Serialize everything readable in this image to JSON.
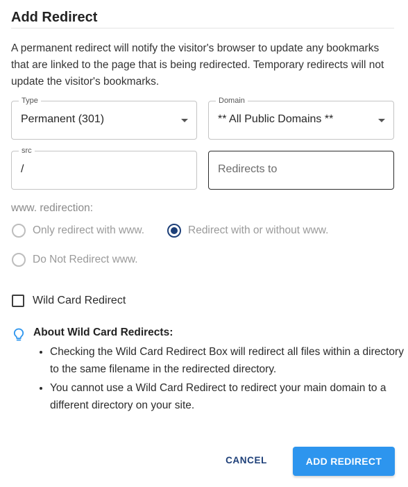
{
  "dialog": {
    "title": "Add Redirect",
    "description": "A permanent redirect will notify the visitor's browser to update any bookmarks that are linked to the page that is being redirected. Temporary redirects will not update the visitor's bookmarks."
  },
  "type_select": {
    "label": "Type",
    "value": "Permanent (301)"
  },
  "domain_select": {
    "label": "Domain",
    "value": "** All Public Domains **"
  },
  "src_field": {
    "label": "src",
    "value": "/"
  },
  "redirects_to_field": {
    "placeholder": "Redirects to",
    "value": ""
  },
  "www_redirection": {
    "label": "www. redirection:",
    "options": [
      {
        "label": "Only redirect with www.",
        "checked": false
      },
      {
        "label": "Redirect with or without www.",
        "checked": true
      },
      {
        "label": "Do Not Redirect www.",
        "checked": false
      }
    ]
  },
  "wildcard": {
    "label": "Wild Card Redirect",
    "checked": false
  },
  "info": {
    "icon": "lightbulb-icon",
    "title": "About Wild Card Redirects:",
    "items": [
      "Checking the Wild Card Redirect Box will redirect all files within a directory to the same filename in the redirected directory.",
      "You cannot use a Wild Card Redirect to redirect your main domain to a different directory on your site."
    ]
  },
  "actions": {
    "cancel": "CANCEL",
    "submit": "ADD REDIRECT"
  },
  "colors": {
    "primary": "#2d95ee",
    "accent": "#1d3f78",
    "info_icon": "#2d95ee"
  }
}
